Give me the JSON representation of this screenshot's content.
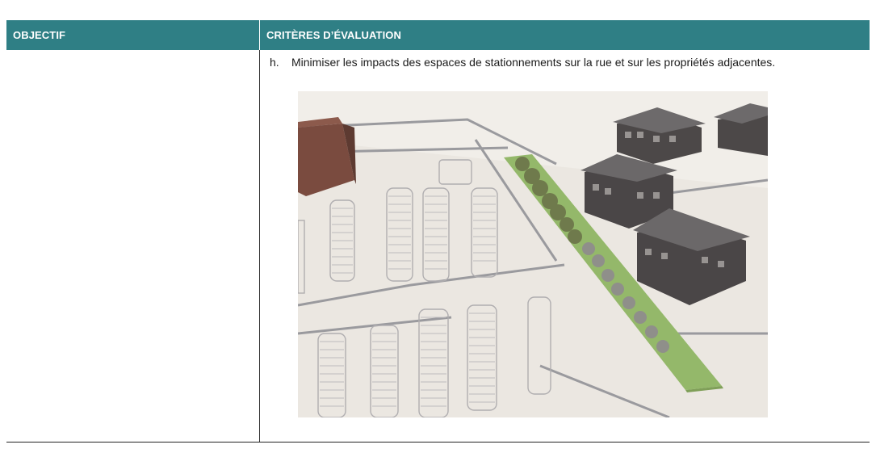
{
  "table": {
    "headers": {
      "objectif": "OBJECTIF",
      "criteres": "CRITÈRES D’ÉVALUATION"
    },
    "rows": [
      {
        "objectif": "",
        "item_marker": "h.",
        "item_text": "Minimiser les impacts des espaces de stationnements sur la rue et sur les propriétés adjacentes."
      }
    ]
  },
  "colors": {
    "header_bg": "#2f7f85",
    "header_text": "#ffffff",
    "green_strip": "#8fb564"
  }
}
